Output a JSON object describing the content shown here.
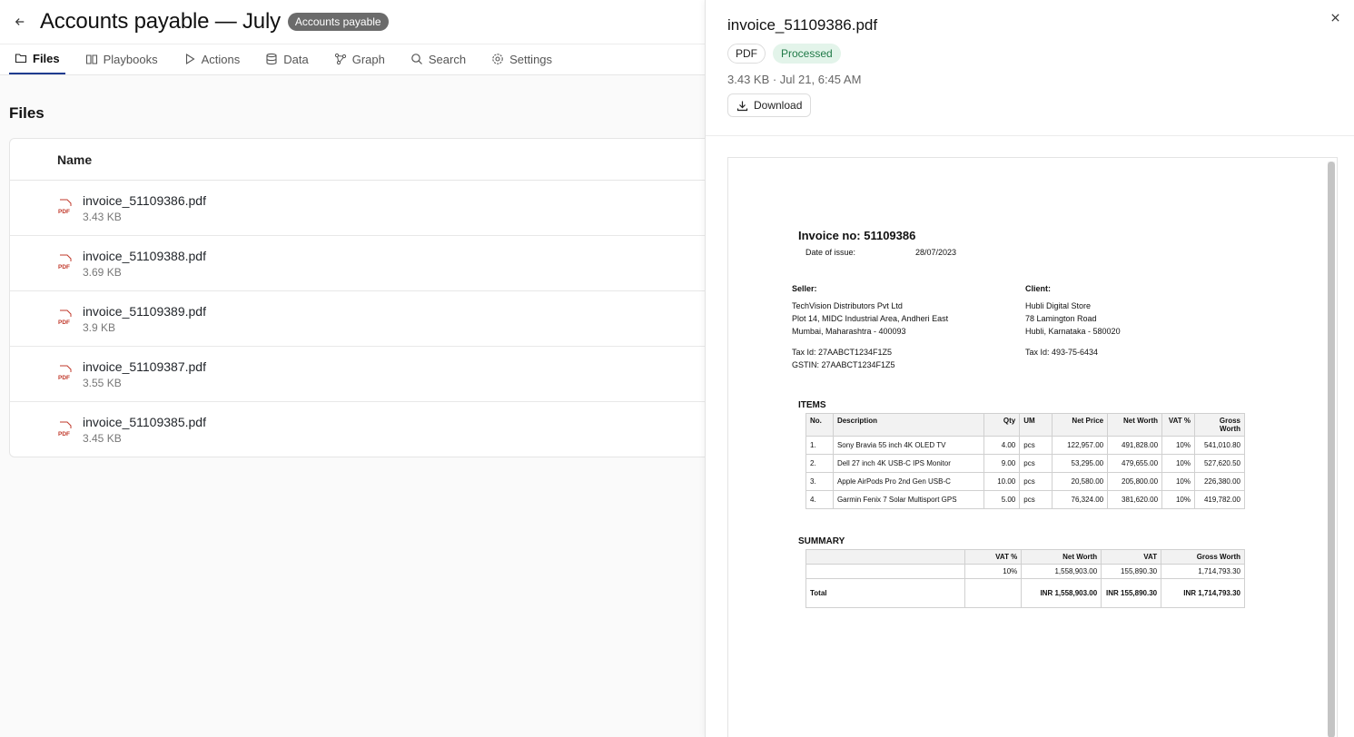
{
  "header": {
    "title": "Accounts payable — July",
    "badge": "Accounts payable"
  },
  "tabs": [
    {
      "label": "Files",
      "icon": "folder-icon",
      "active": true
    },
    {
      "label": "Playbooks",
      "icon": "book-icon"
    },
    {
      "label": "Actions",
      "icon": "play-icon"
    },
    {
      "label": "Data",
      "icon": "database-icon"
    },
    {
      "label": "Graph",
      "icon": "graph-icon"
    },
    {
      "label": "Search",
      "icon": "search-icon"
    },
    {
      "label": "Settings",
      "icon": "gear-icon"
    }
  ],
  "files_section": {
    "title": "Files",
    "column_name": "Name",
    "rows": [
      {
        "name": "invoice_51109386.pdf",
        "size": "3.43 KB"
      },
      {
        "name": "invoice_51109388.pdf",
        "size": "3.69 KB"
      },
      {
        "name": "invoice_51109389.pdf",
        "size": "3.9 KB"
      },
      {
        "name": "invoice_51109387.pdf",
        "size": "3.55 KB"
      },
      {
        "name": "invoice_51109385.pdf",
        "size": "3.45 KB"
      }
    ]
  },
  "drawer": {
    "title": "invoice_51109386.pdf",
    "type_badge": "PDF",
    "status_badge": "Processed",
    "meta": "3.43 KB · Jul 21, 6:45 AM",
    "download_label": "Download"
  },
  "invoice": {
    "title": "Invoice no: 51109386",
    "date_label": "Date of issue:",
    "date_value": "28/07/2023",
    "seller": {
      "heading": "Seller:",
      "lines": [
        "TechVision Distributors Pvt Ltd",
        "Plot 14, MIDC Industrial Area, Andheri East",
        "Mumbai, Maharashtra - 400093"
      ],
      "tax_lines": [
        "Tax Id: 27AABCT1234F1Z5",
        "GSTIN: 27AABCT1234F1Z5"
      ]
    },
    "client": {
      "heading": "Client:",
      "lines": [
        "Hubli Digital Store",
        "78 Lamington Road",
        "Hubli, Karnataka - 580020"
      ],
      "tax_lines": [
        "Tax Id: 493-75-6434"
      ]
    },
    "items_label": "ITEMS",
    "items_headers": [
      "No.",
      "Description",
      "Qty",
      "UM",
      "Net Price",
      "Net Worth",
      "VAT %",
      "Gross Worth"
    ],
    "items": [
      [
        "1.",
        "Sony Bravia 55 inch 4K OLED TV",
        "4.00",
        "pcs",
        "122,957.00",
        "491,828.00",
        "10%",
        "541,010.80"
      ],
      [
        "2.",
        "Dell 27 inch 4K USB-C IPS Monitor",
        "9.00",
        "pcs",
        "53,295.00",
        "479,655.00",
        "10%",
        "527,620.50"
      ],
      [
        "3.",
        "Apple AirPods Pro 2nd Gen USB-C",
        "10.00",
        "pcs",
        "20,580.00",
        "205,800.00",
        "10%",
        "226,380.00"
      ],
      [
        "4.",
        "Garmin Fenix 7 Solar Multisport GPS",
        "5.00",
        "pcs",
        "76,324.00",
        "381,620.00",
        "10%",
        "419,782.00"
      ]
    ],
    "summary_label": "SUMMARY",
    "summary_headers": [
      "",
      "VAT %",
      "Net Worth",
      "VAT",
      "Gross Worth"
    ],
    "summary_rows": [
      [
        "",
        "10%",
        "1,558,903.00",
        "155,890.30",
        "1,714,793.30"
      ],
      [
        "Total",
        "",
        "INR 1,558,903.00",
        "INR 155,890.30",
        "INR 1,714,793.30"
      ]
    ]
  }
}
